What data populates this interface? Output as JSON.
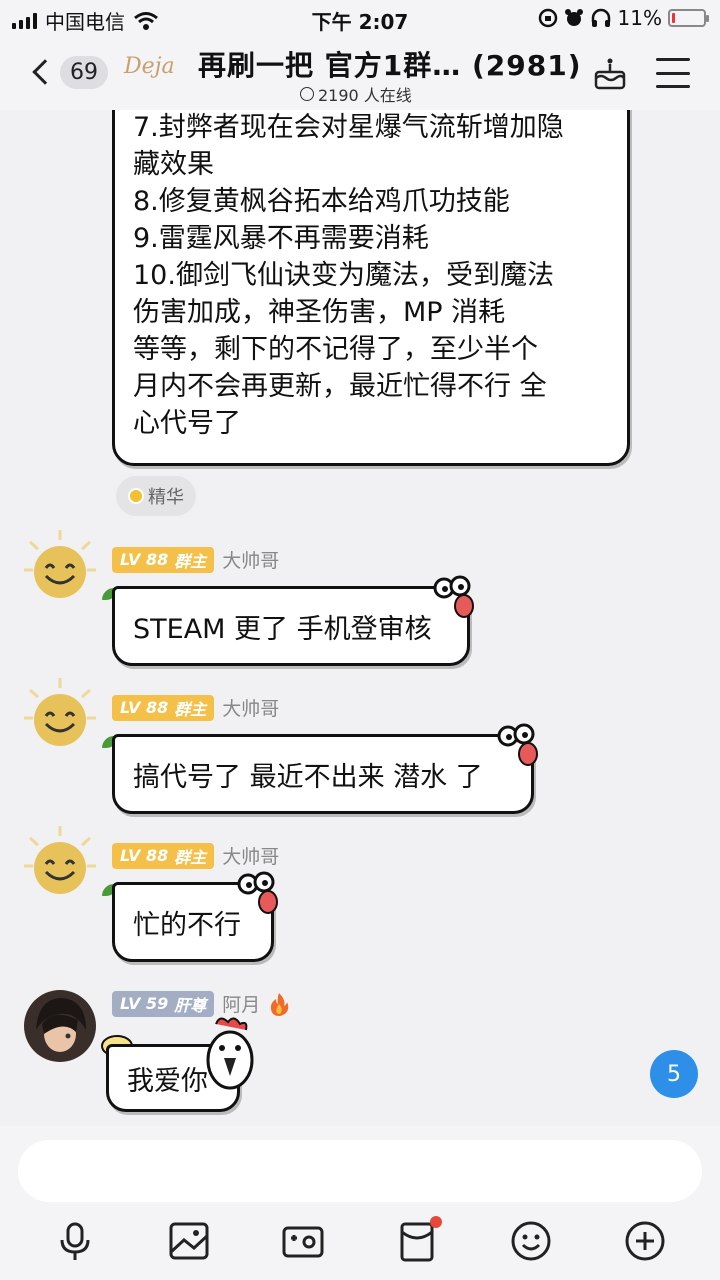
{
  "status_bar": {
    "carrier": "中国电信",
    "time": "下午 2:07",
    "battery_percent": "11%",
    "battery_level": 0.11
  },
  "header": {
    "back_count": "69",
    "logo_text": "Deja",
    "title": "再刷一把 官方1群…  (2981)",
    "online_text": "2190 人在线"
  },
  "top_message": {
    "lines": [
      "7.封弊者现在会对星爆气流斩增加隐",
      "藏效果",
      "8.修复黄枫谷拓本给鸡爪功技能",
      "9.雷霆风暴不再需要消耗",
      "10.御剑飞仙诀变为魔法，受到魔法",
      "伤害加成，神圣伤害，MP 消耗",
      "等等，剩下的不记得了，至少半个",
      "月内不会再更新，最近忙得不行 全",
      "心代号了"
    ],
    "essence_label": "精华"
  },
  "messages": [
    {
      "level": "LV 88",
      "role": "群主",
      "nickname": "大帅哥",
      "text": "STEAM 更了 手机登审核"
    },
    {
      "level": "LV 88",
      "role": "群主",
      "nickname": "大帅哥",
      "text": "搞代号了 最近不出来 潜水 了"
    },
    {
      "level": "LV 88",
      "role": "群主",
      "nickname": "大帅哥",
      "text": "忙的不行"
    },
    {
      "level": "LV 59",
      "role": "肝尊",
      "nickname": "阿月",
      "text": "我爱你"
    }
  ],
  "new_message_count": "5",
  "input": {
    "placeholder": ""
  },
  "toolbar": [
    "mic-icon",
    "image-icon",
    "camera-icon",
    "red-packet-icon",
    "emoji-icon",
    "plus-icon"
  ],
  "colors": {
    "owner_badge": "#f4c04a",
    "user_badge": "#a3aec4",
    "accent": "#2d8fe8"
  }
}
